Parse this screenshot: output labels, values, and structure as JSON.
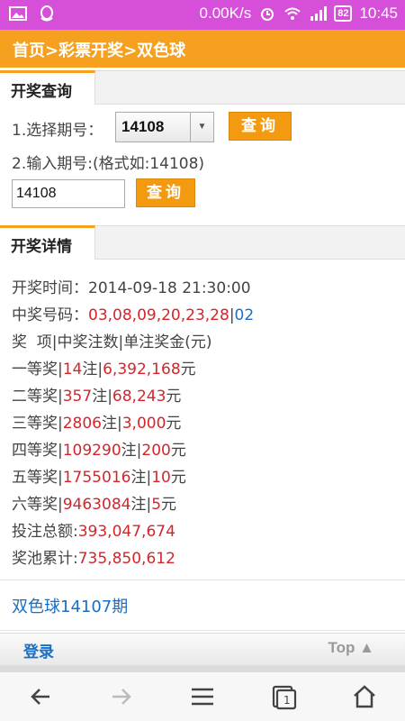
{
  "status_bar": {
    "speed": "0.00K/s",
    "battery": "82",
    "time": "10:45"
  },
  "header": {
    "breadcrumb": "首页>彩票开奖>双色球"
  },
  "query_section": {
    "tab_label": "开奖查询",
    "select_label": "1.选择期号：",
    "select_value": "14108",
    "query_button": "查询",
    "input_label": "2.输入期号:(格式如:14108)",
    "input_value": "14108",
    "query_button2": "查询"
  },
  "detail_section": {
    "tab_label": "开奖详情",
    "draw_time_label": "开奖时间：",
    "draw_time": "2014-09-18 21:30:00",
    "numbers_label": "中奖号码：",
    "red_numbers": "03,08,09,20,23,28",
    "separator": "|",
    "blue_number": "02",
    "table_header": "奖  项|中奖注数|单注奖金(元)",
    "prizes": [
      {
        "name": "一等奖",
        "count": "14",
        "amount": "6,392,168"
      },
      {
        "name": "二等奖",
        "count": "357",
        "amount": "68,243"
      },
      {
        "name": "三等奖",
        "count": "2806",
        "amount": "3,000"
      },
      {
        "name": "四等奖",
        "count": "109290",
        "amount": "200"
      },
      {
        "name": "五等奖",
        "count": "1755016",
        "amount": "10"
      },
      {
        "name": "六等奖",
        "count": "9463084",
        "amount": "5"
      }
    ],
    "count_unit": "注",
    "amount_unit": "元",
    "total_bet_label": "投注总额:",
    "total_bet": "393,047,674",
    "pool_label": "奖池累计:",
    "pool": "735,850,612"
  },
  "prev_link": "双色球14107期",
  "footer": {
    "login": "登录",
    "top": "Top ▲"
  },
  "colors": {
    "header": "#f5a01e",
    "status": "#d64fd8",
    "red": "#d6242a",
    "blue": "#1a6fc4"
  }
}
